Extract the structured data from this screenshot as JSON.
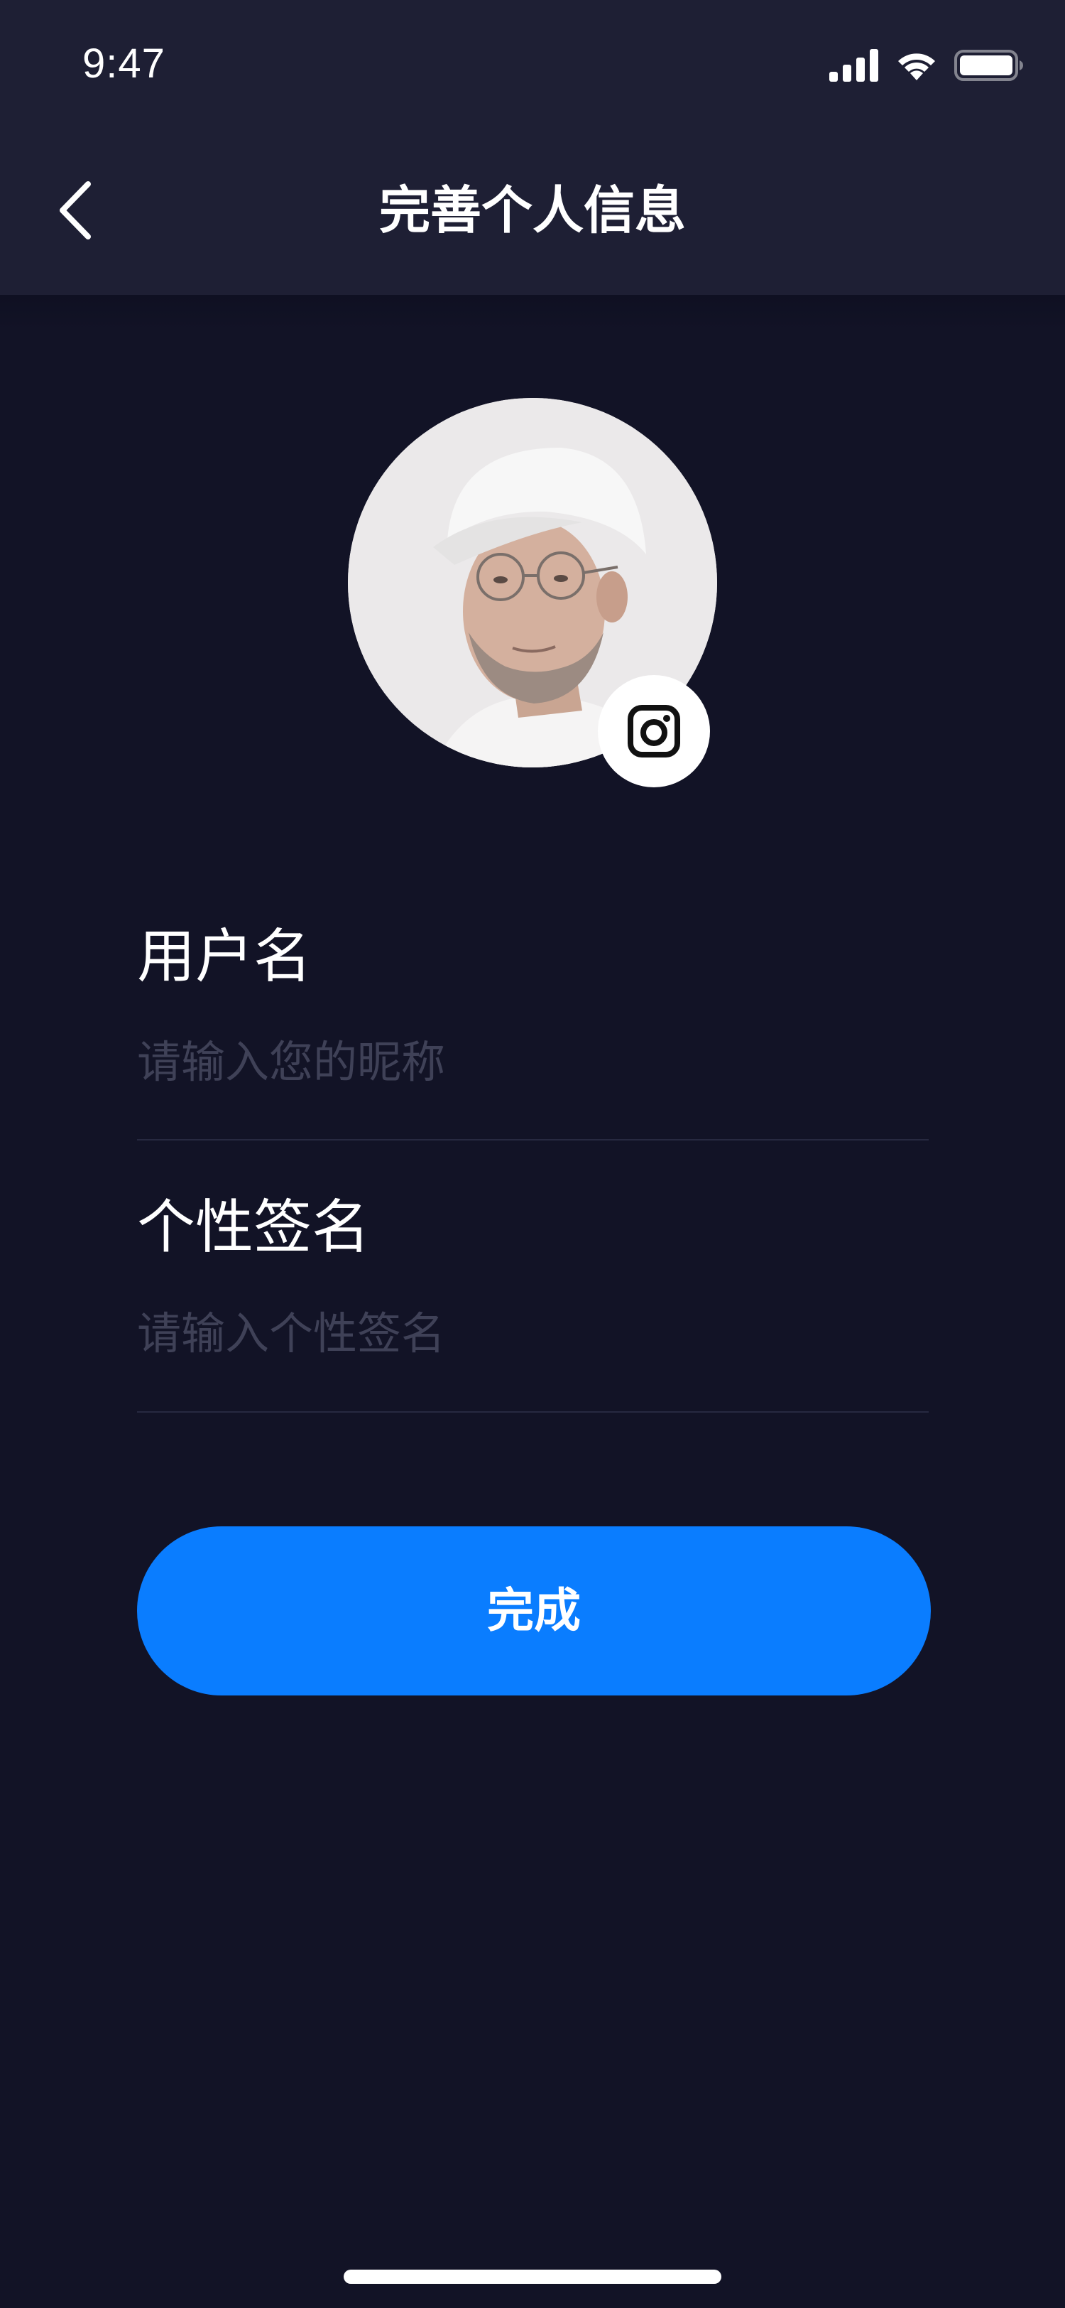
{
  "status_bar": {
    "time": "9:47",
    "icons": [
      "cellular-signal-icon",
      "wifi-icon",
      "battery-icon"
    ]
  },
  "nav": {
    "title": "完善个人信息",
    "back_icon": "chevron-left-icon"
  },
  "avatar": {
    "edit_icon": "camera-icon"
  },
  "form": {
    "username": {
      "label": "用户名",
      "placeholder": "请输入您的昵称",
      "value": ""
    },
    "signature": {
      "label": "个性签名",
      "placeholder": "请输入个性签名",
      "value": ""
    }
  },
  "actions": {
    "submit_label": "完成"
  },
  "colors": {
    "background": "#121326",
    "header": "#1e1f34",
    "accent": "#0a7dff",
    "placeholder": "#3f4157"
  }
}
